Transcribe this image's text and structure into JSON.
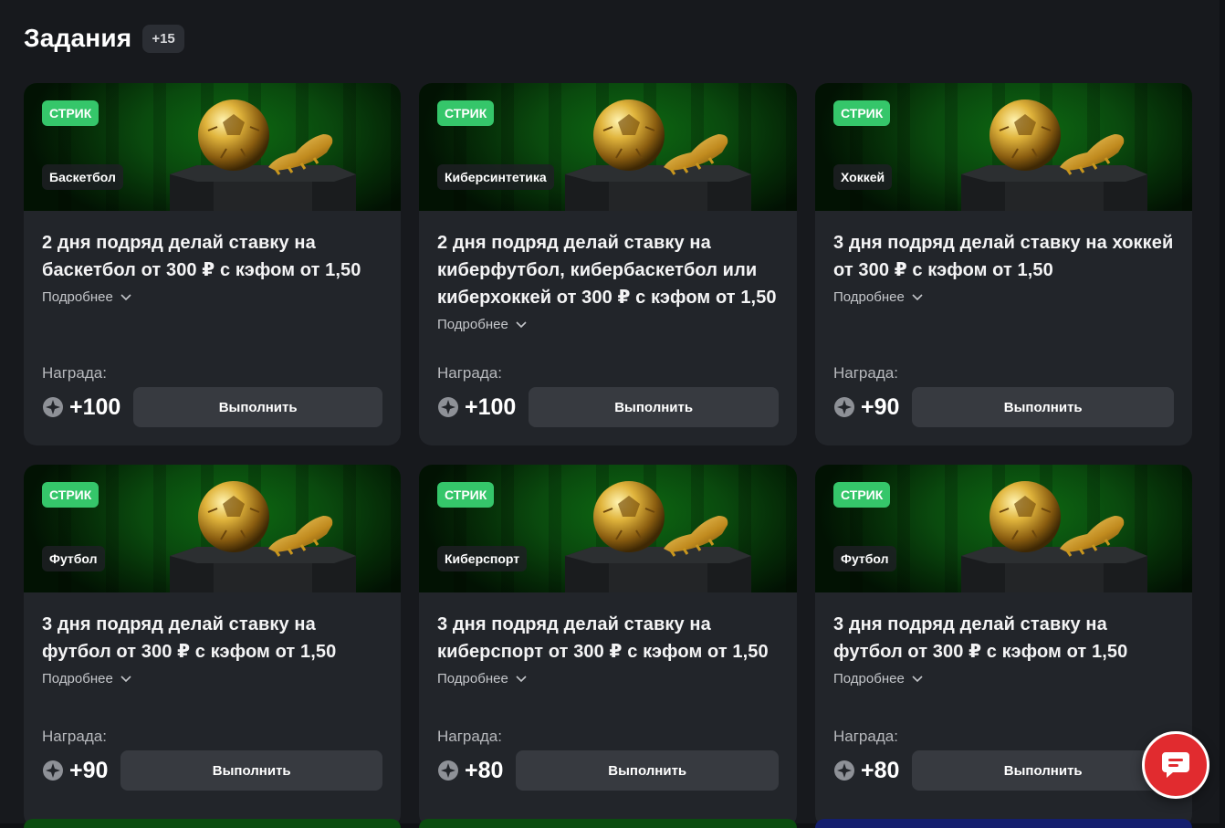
{
  "header": {
    "title": "Задания",
    "count": "+15"
  },
  "cards": [
    {
      "streak": "СТРИК",
      "sport": "Баскетбол",
      "task": "2 дня подряд делай ставку на баскетбол от 300 ₽ с кэфом от 1,50",
      "more": "Подробнее",
      "reward_label": "Награда:",
      "reward": "+100",
      "action": "Выполнить"
    },
    {
      "streak": "СТРИК",
      "sport": "Киберсинтетика",
      "task": "2 дня подряд делай ставку на киберфутбол, кибербаскетбол или киберхоккей от 300 ₽ с кэфом от 1,50",
      "more": "Подробнее",
      "reward_label": "Награда:",
      "reward": "+100",
      "action": "Выполнить"
    },
    {
      "streak": "СТРИК",
      "sport": "Хоккей",
      "task": "3 дня подряд делай ставку на хоккей от 300 ₽ с кэфом от 1,50",
      "more": "Подробнее",
      "reward_label": "Награда:",
      "reward": "+90",
      "action": "Выполнить"
    },
    {
      "streak": "СТРИК",
      "sport": "Футбол",
      "task": "3 дня подряд делай ставку на футбол от 300 ₽ с кэфом от 1,50",
      "more": "Подробнее",
      "reward_label": "Награда:",
      "reward": "+90",
      "action": "Выполнить"
    },
    {
      "streak": "СТРИК",
      "sport": "Киберспорт",
      "task": "3 дня подряд делай ставку на киберспорт от 300 ₽ с кэфом от 1,50",
      "more": "Подробнее",
      "reward_label": "Награда:",
      "reward": "+80",
      "action": "Выполнить"
    },
    {
      "streak": "СТРИК",
      "sport": "Футбол",
      "task": "3 дня подряд делай ставку на футбол от 300 ₽ с кэфом от 1,50",
      "more": "Подробнее",
      "reward_label": "Награда:",
      "reward": "+80",
      "action": "Выполнить"
    }
  ],
  "icons": {
    "coin": "bonus-coin-icon",
    "chevron": "chevron-down-icon",
    "chat": "chat-icon"
  },
  "colors": {
    "streak": "#35c66a",
    "chat_button": "#e12b2f",
    "background": "#17191d",
    "card": "#22252a"
  }
}
